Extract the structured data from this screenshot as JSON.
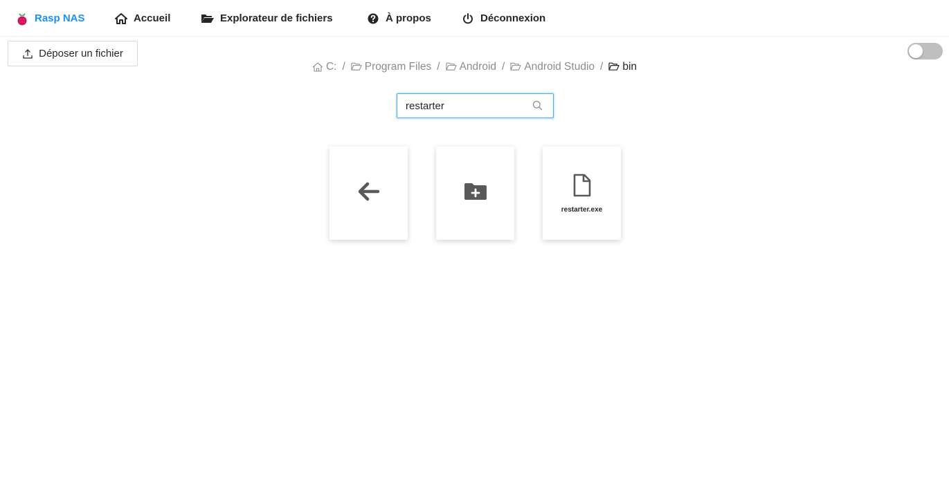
{
  "nav": {
    "brand": "Rasp NAS",
    "home": "Accueil",
    "explorer": "Explorateur de fichiers",
    "about": "À propos",
    "logout": "Déconnexion",
    "brand_color": "#1890ff"
  },
  "toolbar": {
    "upload_label": "Déposer un fichier"
  },
  "theme_toggle": {
    "state": "off"
  },
  "breadcrumb": [
    {
      "label": "C:",
      "icon": "home-icon"
    },
    {
      "label": "Program Files",
      "icon": "folder-open-icon"
    },
    {
      "label": "Android",
      "icon": "folder-open-icon"
    },
    {
      "label": "Android Studio",
      "icon": "folder-open-icon"
    },
    {
      "label": "bin",
      "icon": "folder-open-icon"
    }
  ],
  "search": {
    "value": "restarter",
    "placeholder": ""
  },
  "cards": [
    {
      "type": "back",
      "icon": "arrow-left-icon"
    },
    {
      "type": "new-folder",
      "icon": "folder-plus-icon"
    },
    {
      "type": "file",
      "icon": "file-icon",
      "name": "restarter.exe"
    }
  ]
}
